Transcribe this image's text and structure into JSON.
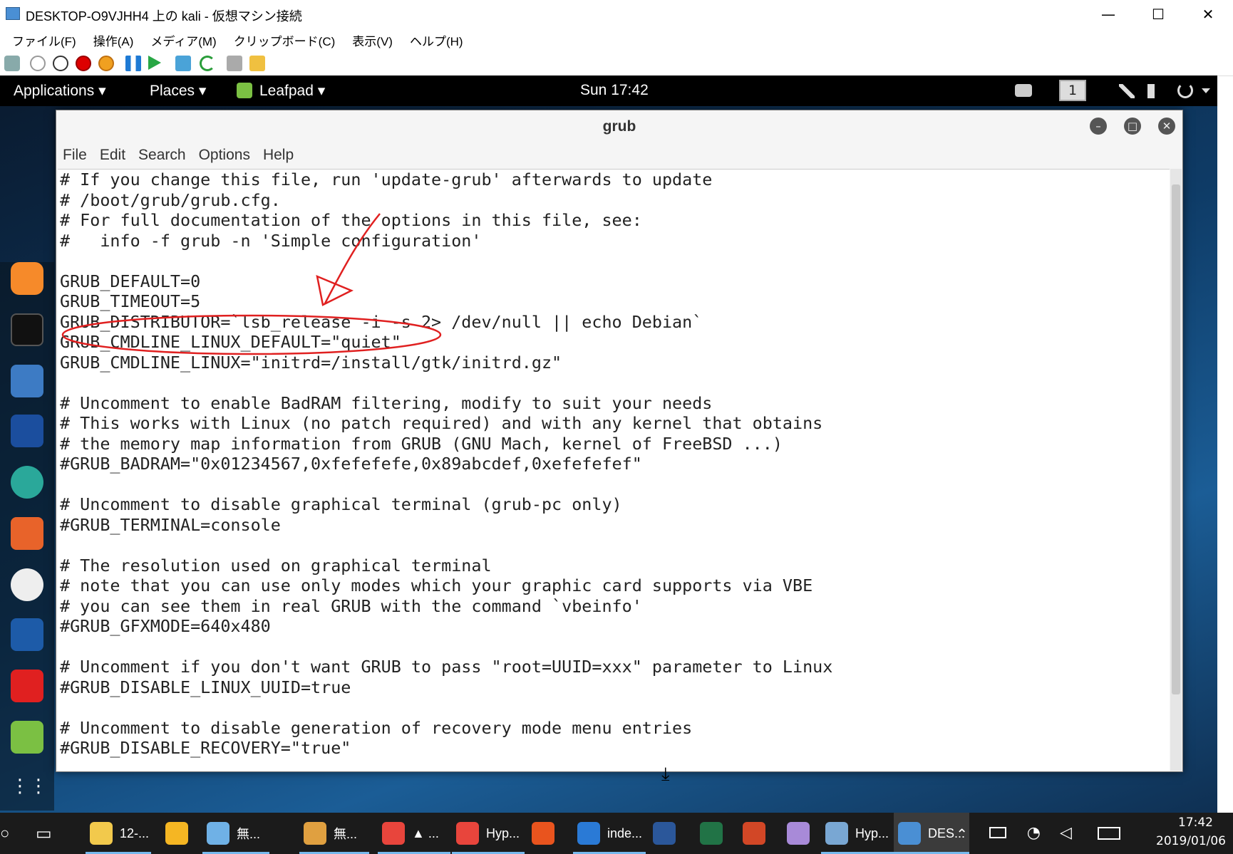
{
  "host_window": {
    "title": "DESKTOP-O9VJHH4 上の kali  - 仮想マシン接続",
    "controls": {
      "minimize": "—",
      "maximize": "☐",
      "close": "✕"
    },
    "menu": [
      "ファイル(F)",
      "操作(A)",
      "メディア(M)",
      "クリップボード(C)",
      "表示(V)",
      "ヘルプ(H)"
    ]
  },
  "kali_panel": {
    "applications": "Applications ▾",
    "places": "Places ▾",
    "leafpad": "Leafpad ▾",
    "clock": "Sun 17:42",
    "workspace": "1"
  },
  "leafpad": {
    "title": "grub",
    "menu": [
      "File",
      "Edit",
      "Search",
      "Options",
      "Help"
    ],
    "lines": [
      "# If you change this file, run 'update-grub' afterwards to update",
      "# /boot/grub/grub.cfg.",
      "# For full documentation of the options in this file, see:",
      "#   info -f grub -n 'Simple configuration'",
      "",
      "GRUB_DEFAULT=0",
      "GRUB_TIMEOUT=5",
      "GRUB_DISTRIBUTOR=`lsb_release -i -s 2> /dev/null || echo Debian`",
      "GRUB_CMDLINE_LINUX_DEFAULT=\"quiet\"",
      "GRUB_CMDLINE_LINUX=\"initrd=/install/gtk/initrd.gz\"",
      "",
      "# Uncomment to enable BadRAM filtering, modify to suit your needs",
      "# This works with Linux (no patch required) and with any kernel that obtains",
      "# the memory map information from GRUB (GNU Mach, kernel of FreeBSD ...)",
      "#GRUB_BADRAM=\"0x01234567,0xfefefefe,0x89abcdef,0xefefefef\"",
      "",
      "# Uncomment to disable graphical terminal (grub-pc only)",
      "#GRUB_TERMINAL=console",
      "",
      "# The resolution used on graphical terminal",
      "# note that you can use only modes which your graphic card supports via VBE",
      "# you can see them in real GRUB with the command `vbeinfo'",
      "#GRUB_GFXMODE=640x480",
      "",
      "# Uncomment if you don't want GRUB to pass \"root=UUID=xxx\" parameter to Linux",
      "#GRUB_DISABLE_LINUX_UUID=true",
      "",
      "# Uncomment to disable generation of recovery mode menu entries",
      "#GRUB_DISABLE_RECOVERY=\"true\""
    ]
  },
  "taskbar": {
    "items": [
      {
        "label": "12-...",
        "color": "#f2c94c"
      },
      {
        "label": "",
        "color": "#f5b623"
      },
      {
        "label": "無...",
        "color": "#6fb1e6"
      },
      {
        "label": "無...",
        "color": "#e0a040"
      },
      {
        "label": "▲ ...",
        "color": "#e8453c"
      },
      {
        "label": "Hyp...",
        "color": "#e8453c"
      },
      {
        "label": "",
        "color": "#e9541e"
      },
      {
        "label": "inde...",
        "color": "#2a7ad6"
      },
      {
        "label": "",
        "color": "#2b579a"
      },
      {
        "label": "",
        "color": "#217346"
      },
      {
        "label": "",
        "color": "#d24726"
      },
      {
        "label": "",
        "color": "#a88ad8"
      },
      {
        "label": "Hyp...",
        "color": "#79a7d3"
      },
      {
        "label": "DES...",
        "color": "#4a8fd4"
      }
    ],
    "time": "17:42",
    "date": "2019/01/06"
  }
}
